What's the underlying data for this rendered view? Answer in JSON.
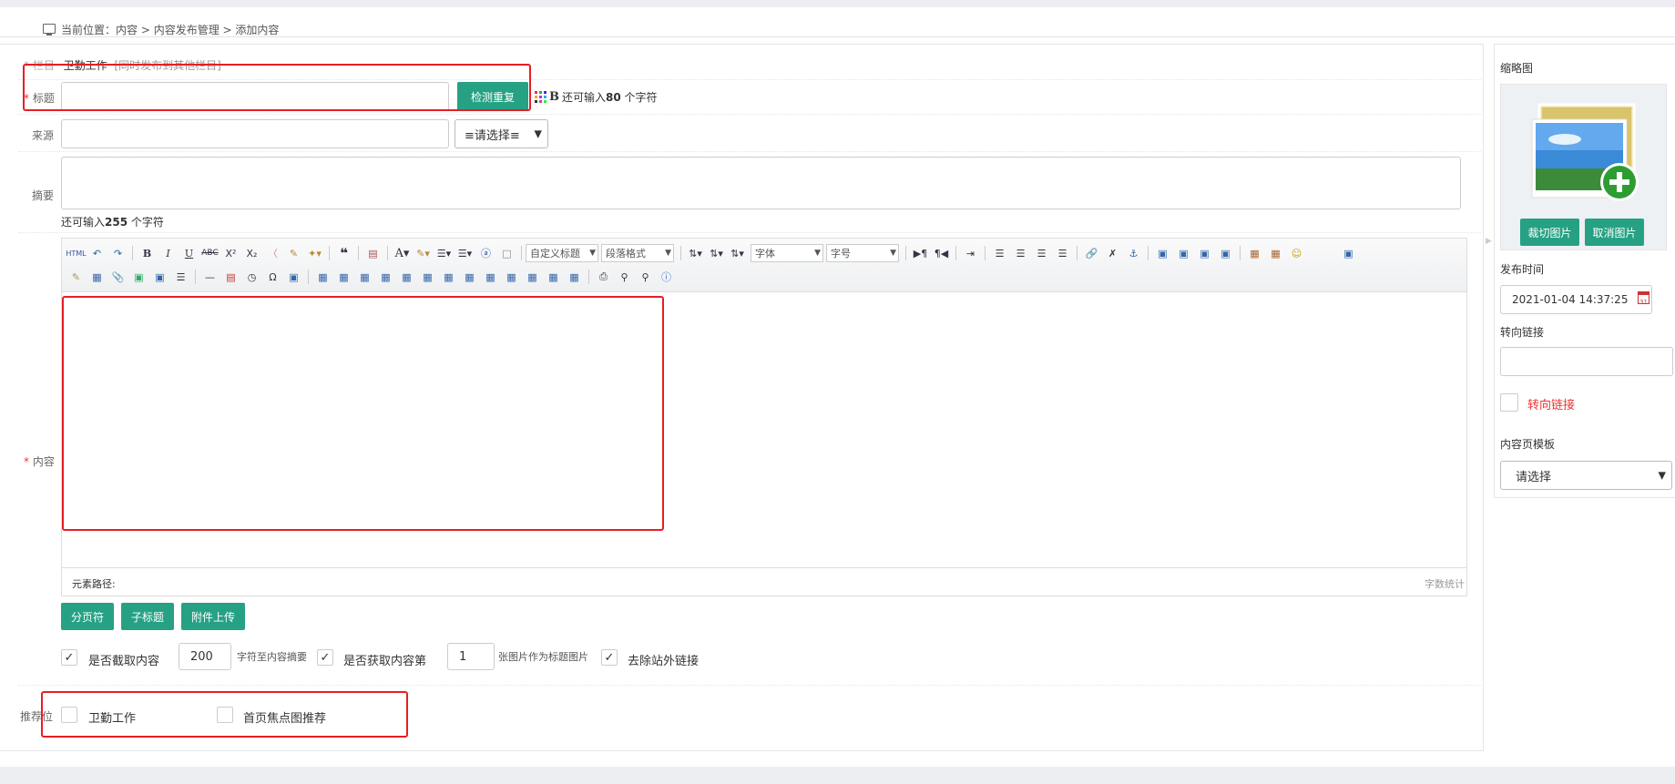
{
  "breadcrumb": {
    "prefix": "当前位置：",
    "items": [
      "内容",
      "内容发布管理",
      "添加内容"
    ],
    "sep": " > "
  },
  "form": {
    "column": {
      "label": "* 栏目",
      "value": "卫勤工作",
      "sync_link": "[同时发布到其他栏目]"
    },
    "title": {
      "star": "*",
      "label": "标题",
      "value": "",
      "check_button": "检测重复",
      "remaining_prefix": "还可输入",
      "remaining_count": "80",
      "remaining_suffix": " 个字符"
    },
    "source": {
      "label": "来源",
      "value": "",
      "select_value": "≡请选择≡"
    },
    "summary": {
      "label": "摘要",
      "value": "",
      "remaining_prefix": "还可输入",
      "remaining_count": "255",
      "remaining_suffix": " 个字符"
    },
    "content": {
      "star": "*",
      "label": "内容"
    },
    "editor": {
      "font_select": "字体",
      "size_select": "字号",
      "heading_select": "自定义标题",
      "para_select": "段落格式",
      "path_label": "元素路径:",
      "word_count": "字数统计"
    },
    "buttons": {
      "page_break": "分页符",
      "subtitle": "子标题",
      "attach": "附件上传"
    },
    "options": {
      "cut_content_label": "是否截取内容",
      "cut_content_value": "200",
      "cut_content_suffix": "字符至内容摘要",
      "get_image_label": "是否获取内容第",
      "get_image_value": "1",
      "get_image_suffix": "张图片作为标题图片",
      "remove_links_label": "去除站外链接"
    },
    "recommend": {
      "label": "推荐位",
      "opt1": "卫勤工作",
      "opt2": "首页焦点图推荐"
    }
  },
  "sidebar": {
    "thumb_label": "缩略图",
    "crop_button": "裁切图片",
    "cancel_button": "取消图片",
    "publish_label": "发布时间",
    "publish_value": "2021-01-04 14:37:25",
    "redirect_label": "转向链接",
    "redirect_value": "",
    "redirect_check_label": "转向链接",
    "template_label": "内容页模板",
    "template_value": "请选择"
  },
  "colors": {
    "accent": "#26a183",
    "highlight": "#e81e25"
  }
}
